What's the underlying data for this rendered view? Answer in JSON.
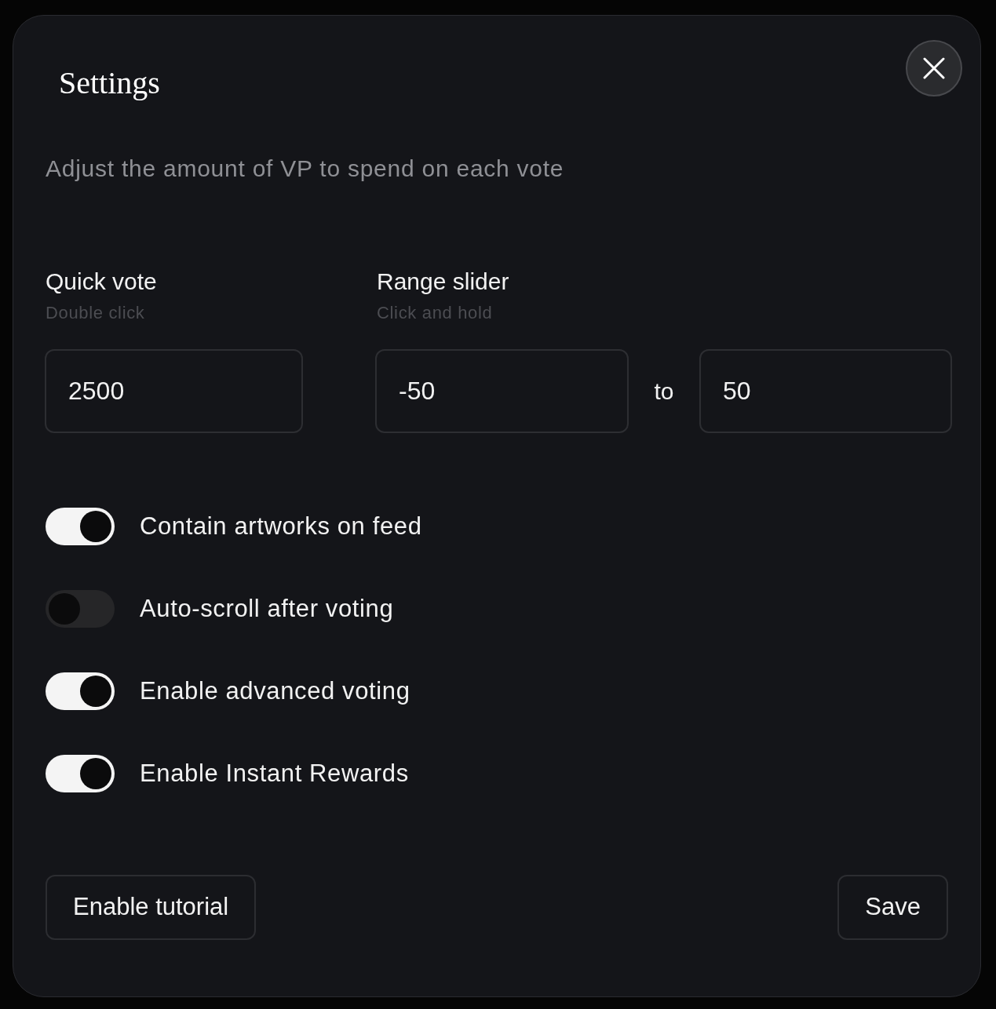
{
  "dialog": {
    "title": "Settings",
    "description": "Adjust the amount of VP to spend on each vote"
  },
  "quick_vote": {
    "label": "Quick vote",
    "hint": "Double click",
    "value": "2500"
  },
  "range_slider": {
    "label": "Range slider",
    "hint": "Click and hold",
    "from": "-50",
    "separator": "to",
    "to": "50"
  },
  "toggles": [
    {
      "label": "Contain artworks on feed",
      "on": true
    },
    {
      "label": "Auto-scroll after voting",
      "on": false
    },
    {
      "label": "Enable advanced voting",
      "on": true
    },
    {
      "label": "Enable Instant Rewards",
      "on": true
    }
  ],
  "buttons": [
    {
      "label": "Enable tutorial"
    },
    {
      "label": "Save"
    }
  ]
}
